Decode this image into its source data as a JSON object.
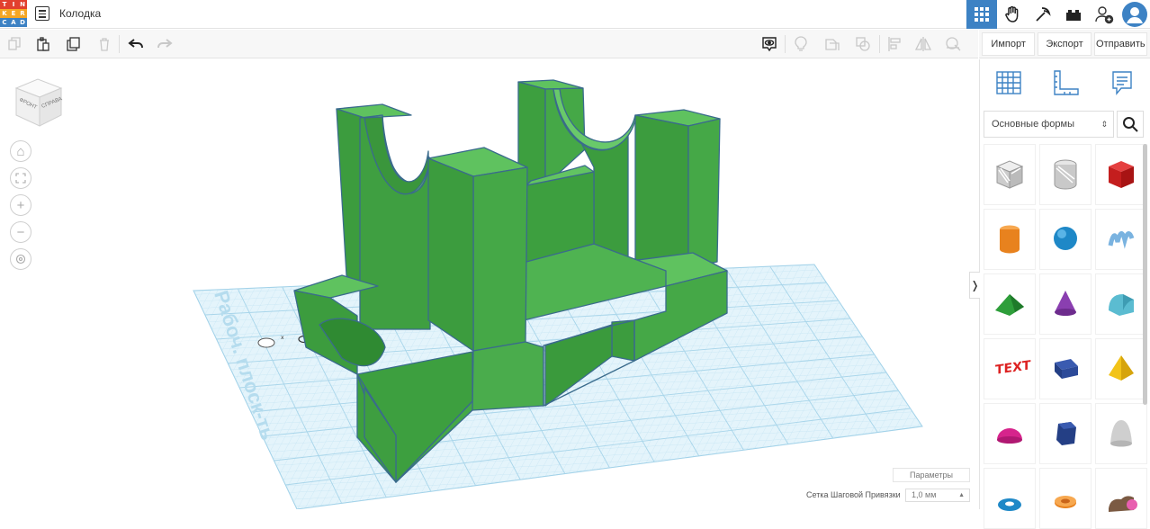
{
  "app": {
    "logo_letters": [
      "T",
      "I",
      "N",
      "K",
      "E",
      "R",
      "C",
      "A",
      "D"
    ],
    "logo_colors": [
      "#e2402e",
      "#e2402e",
      "#e2402e",
      "#f5a623",
      "#f5a623",
      "#f5a623",
      "#3d82c4",
      "#3d82c4",
      "#3d82c4"
    ],
    "document_title": "Колодка"
  },
  "header_icons": [
    "grid-view-icon",
    "hand-drag-icon",
    "tools-icon",
    "bricks-icon",
    "add-user-icon",
    "profile-avatar"
  ],
  "toolbar": {
    "icons": [
      "copy-icon",
      "paste-icon",
      "duplicate-icon",
      "delete-icon",
      "undo-icon",
      "redo-icon",
      "show-hide-icon",
      "light-icon",
      "group-icon",
      "ungroup-icon",
      "align-icon",
      "mirror-icon",
      "workplane-icon"
    ],
    "import_label": "Импорт",
    "export_label": "Экспорт",
    "send_label": "Отправить"
  },
  "viewport": {
    "viewcube_front": "ФРОНТ",
    "viewcube_right": "СПРАВА",
    "workplane_label": "Рабоч. плоск-ть",
    "params_label": "Параметры",
    "snap_label": "Сетка Шаговой Привязки",
    "snap_value": "1,0 мм",
    "accent_green": "#45a847",
    "grid_color": "#9fd0e8"
  },
  "panel": {
    "tab_icons": [
      "workplane-grid-icon",
      "ruler-icon",
      "notes-icon"
    ],
    "category_selected": "Основные формы",
    "shapes": [
      {
        "name": "box-hole"
      },
      {
        "name": "cylinder-hole"
      },
      {
        "name": "box"
      },
      {
        "name": "cylinder"
      },
      {
        "name": "sphere"
      },
      {
        "name": "scribble"
      },
      {
        "name": "roof"
      },
      {
        "name": "cone"
      },
      {
        "name": "round-roof"
      },
      {
        "name": "text"
      },
      {
        "name": "prism"
      },
      {
        "name": "pyramid"
      },
      {
        "name": "half-sphere"
      },
      {
        "name": "polygon"
      },
      {
        "name": "paraboloid"
      },
      {
        "name": "torus"
      },
      {
        "name": "tube"
      },
      {
        "name": "shape-generator"
      }
    ]
  }
}
